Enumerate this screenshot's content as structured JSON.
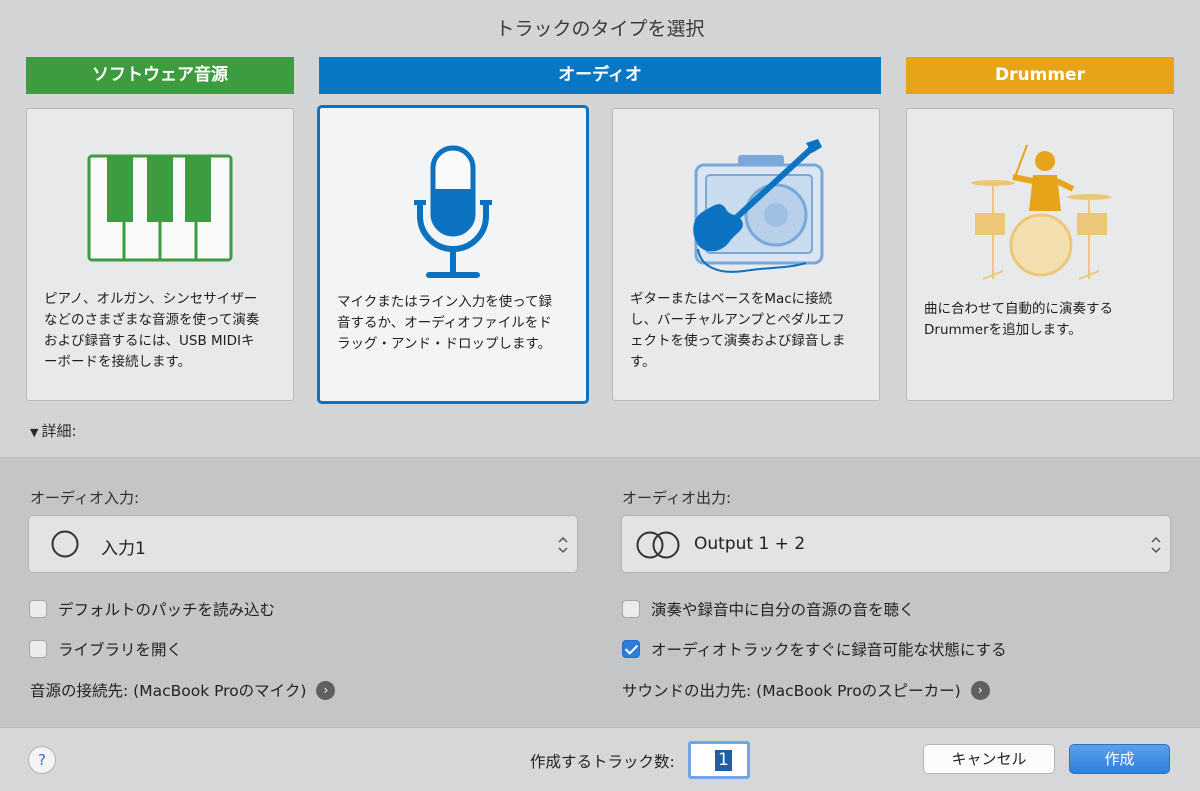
{
  "dialog": {
    "title": "トラックのタイプを選択"
  },
  "categories": {
    "software": "ソフトウェア音源",
    "audio": "オーディオ",
    "drummer": "Drummer"
  },
  "cards": [
    {
      "id": "software-instrument",
      "desc": [
        "ピアノ、オルガン、シンセサイザー",
        "などのさまざまな音源を使って演奏",
        "および録音するには、USB MIDIキ",
        "ーボードを接続します。"
      ]
    },
    {
      "id": "microphone",
      "desc": [
        "マイクまたはライン入力を使って録",
        "音するか、オーディオファイルをド",
        "ラッグ・アンド・ドロップします。"
      ]
    },
    {
      "id": "guitar",
      "desc": [
        "ギターまたはベースをMacに接続",
        "し、バーチャルアンプとペダルエフ",
        "ェクトを使って演奏および録音しま",
        "す。"
      ]
    },
    {
      "id": "drummer",
      "desc": [
        "曲に合わせて自動的に演奏する",
        "Drummerを追加します。"
      ]
    }
  ],
  "details": {
    "label": "詳細:",
    "triangle": "▼"
  },
  "audio_input": {
    "label": "オーディオ入力:",
    "value": "入力1"
  },
  "audio_output": {
    "label": "オーディオ出力:",
    "value": "Output 1 + 2"
  },
  "options": {
    "load_default_patch": {
      "label": "デフォルトのパッチを読み込む",
      "checked": false
    },
    "open_library": {
      "label": "ライブラリを開く",
      "checked": false
    },
    "hear_own_instrument": {
      "label": "演奏や録音中に自分の音源の音を聴く",
      "checked": false
    },
    "record_enable": {
      "label": "オーディオトラックをすぐに録音可能な状態にする",
      "checked": true
    }
  },
  "routing": {
    "input_source": "音源の接続先: (MacBook Proのマイク)",
    "output_dest": "サウンドの出力先: (MacBook Proのスピーカー)"
  },
  "footer": {
    "help": "?",
    "count_label": "作成するトラック数:",
    "count_value": "1",
    "cancel": "キャンセル",
    "create": "作成"
  },
  "colors": {
    "green": "#3c9c3f",
    "blue": "#0878c6",
    "amber": "#e6a41a",
    "accent": "#2f7fdb"
  }
}
